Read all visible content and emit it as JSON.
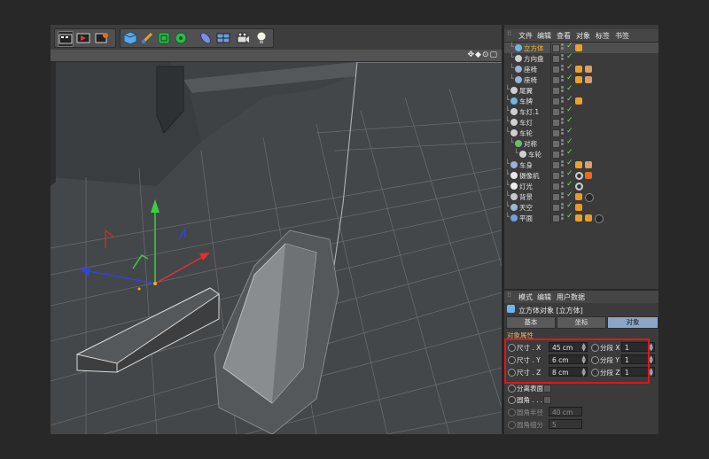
{
  "toolbar": {
    "icons": [
      "render-view-icon",
      "render-picture-viewer-icon",
      "render-settings-icon",
      "cube-icon",
      "pen-icon",
      "subdivision-icon",
      "array-icon",
      "deformer-icon",
      "floor-icon",
      "camera-icon",
      "light-icon"
    ],
    "colors": {
      "accent": "#6fb5e8",
      "green": "#7bd65a"
    }
  },
  "viewport": {
    "nav_icons": "✥◆⊙▢"
  },
  "menu": [
    "文件",
    "编辑",
    "查看",
    "对象",
    "标签",
    "书签"
  ],
  "objects": [
    {
      "name": "立方体",
      "icon": "cube",
      "depth": 1,
      "selected": true,
      "tags": [
        "phong"
      ]
    },
    {
      "name": "方向盘",
      "icon": "null",
      "depth": 1,
      "tags": []
    },
    {
      "name": "座椅",
      "icon": "joint",
      "depth": 1,
      "tags": [
        "phong",
        "checker"
      ]
    },
    {
      "name": "座椅",
      "icon": "joint",
      "depth": 1,
      "tags": [
        "phong",
        "checker"
      ]
    },
    {
      "name": "尾翼",
      "icon": "null",
      "depth": 0,
      "tags": []
    },
    {
      "name": "车牌",
      "icon": "cube",
      "depth": 0,
      "tags": [
        "phong"
      ]
    },
    {
      "name": "车灯.1",
      "icon": "null",
      "depth": 0,
      "tags": []
    },
    {
      "name": "车灯",
      "icon": "null",
      "depth": 0,
      "tags": []
    },
    {
      "name": "车轮",
      "icon": "null",
      "depth": 0,
      "tags": []
    },
    {
      "name": "对称",
      "icon": "symmetry",
      "depth": 1,
      "tags": []
    },
    {
      "name": "车轮",
      "icon": "null",
      "depth": 2,
      "tags": []
    },
    {
      "name": "车身",
      "icon": "joint",
      "depth": 0,
      "tags": [
        "phong",
        "checker"
      ]
    },
    {
      "name": "摄像机",
      "icon": "camera",
      "depth": 0,
      "tags": [
        "target",
        "forbid"
      ]
    },
    {
      "name": "灯光",
      "icon": "light",
      "depth": 0,
      "tags": [
        "target"
      ]
    },
    {
      "name": "背景",
      "icon": "bg",
      "depth": 0,
      "tags": [
        "comp",
        "ball"
      ]
    },
    {
      "name": "天空",
      "icon": "sky",
      "depth": 0,
      "tags": [
        "comp"
      ]
    },
    {
      "name": "平面",
      "icon": "plane",
      "depth": 0,
      "tags": [
        "phong",
        "comp",
        "ball"
      ]
    }
  ],
  "attributes": {
    "header": [
      "模式",
      "编辑",
      "用户数据"
    ],
    "title": "立方体对象 [立方体]",
    "tabs": [
      {
        "label": "基本"
      },
      {
        "label": "坐标"
      },
      {
        "label": "对象",
        "active": true
      }
    ],
    "section_label": "对象属性",
    "size": [
      {
        "label": "尺寸 . X",
        "value": "45 cm",
        "seg_label": "分段 X",
        "seg": "1"
      },
      {
        "label": "尺寸 . Y",
        "value": "6 cm",
        "seg_label": "分段 Y",
        "seg": "1"
      },
      {
        "label": "尺寸 . Z",
        "value": "8 cm",
        "seg_label": "分段 Z",
        "seg": "1"
      }
    ],
    "separate_surfaces": "分离表面",
    "fillet": "圆角 . . .",
    "fillet_radius_label": "圆角半径",
    "fillet_radius": "40 cm",
    "fillet_subdiv_label": "圆角细分",
    "fillet_subdiv": "5"
  }
}
